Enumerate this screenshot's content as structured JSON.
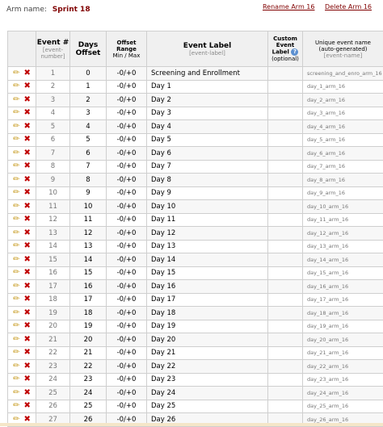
{
  "arm": {
    "label": "Arm name:",
    "name": "Sprint 18",
    "rename_link": "Rename Arm 16",
    "delete_link": "Delete Arm 16"
  },
  "headers": {
    "event_num": "Event #",
    "event_num_sub": "[event-number]",
    "days_offset_1": "Days",
    "days_offset_2": "Offset",
    "offset_range_1": "Offset",
    "offset_range_2": "Range",
    "offset_range_sub": "Min / Max",
    "event_label": "Event Label",
    "event_label_sub": "[event-label]",
    "custom_1": "Custom",
    "custom_2": "Event",
    "custom_3": "Label",
    "custom_sub": "(optional)",
    "unique_1": "Unique event name",
    "unique_2": "(auto-generated)",
    "unique_sub": "[event-name]",
    "help_glyph": "?"
  },
  "icons": {
    "edit": "pencil-icon",
    "delete": "delete-icon",
    "help": "help-icon"
  },
  "events": [
    {
      "num": "1",
      "days": "0",
      "range": "-0/+0",
      "label": "Screening and Enrollment",
      "unique": "screening_and_enro_arm_16"
    },
    {
      "num": "2",
      "days": "1",
      "range": "-0/+0",
      "label": "Day 1",
      "unique": "day_1_arm_16"
    },
    {
      "num": "3",
      "days": "2",
      "range": "-0/+0",
      "label": "Day 2",
      "unique": "day_2_arm_16"
    },
    {
      "num": "4",
      "days": "3",
      "range": "-0/+0",
      "label": "Day 3",
      "unique": "day_3_arm_16"
    },
    {
      "num": "5",
      "days": "4",
      "range": "-0/+0",
      "label": "Day 4",
      "unique": "day_4_arm_16"
    },
    {
      "num": "6",
      "days": "5",
      "range": "-0/+0",
      "label": "Day 5",
      "unique": "day_5_arm_16"
    },
    {
      "num": "7",
      "days": "6",
      "range": "-0/+0",
      "label": "Day 6",
      "unique": "day_6_arm_16"
    },
    {
      "num": "8",
      "days": "7",
      "range": "-0/+0",
      "label": "Day 7",
      "unique": "day_7_arm_16"
    },
    {
      "num": "9",
      "days": "8",
      "range": "-0/+0",
      "label": "Day 8",
      "unique": "day_8_arm_16"
    },
    {
      "num": "10",
      "days": "9",
      "range": "-0/+0",
      "label": "Day 9",
      "unique": "day_9_arm_16"
    },
    {
      "num": "11",
      "days": "10",
      "range": "-0/+0",
      "label": "Day 10",
      "unique": "day_10_arm_16"
    },
    {
      "num": "12",
      "days": "11",
      "range": "-0/+0",
      "label": "Day 11",
      "unique": "day_11_arm_16"
    },
    {
      "num": "13",
      "days": "12",
      "range": "-0/+0",
      "label": "Day 12",
      "unique": "day_12_arm_16"
    },
    {
      "num": "14",
      "days": "13",
      "range": "-0/+0",
      "label": "Day 13",
      "unique": "day_13_arm_16"
    },
    {
      "num": "15",
      "days": "14",
      "range": "-0/+0",
      "label": "Day 14",
      "unique": "day_14_arm_16"
    },
    {
      "num": "16",
      "days": "15",
      "range": "-0/+0",
      "label": "Day 15",
      "unique": "day_15_arm_16"
    },
    {
      "num": "17",
      "days": "16",
      "range": "-0/+0",
      "label": "Day 16",
      "unique": "day_16_arm_16"
    },
    {
      "num": "18",
      "days": "17",
      "range": "-0/+0",
      "label": "Day 17",
      "unique": "day_17_arm_16"
    },
    {
      "num": "19",
      "days": "18",
      "range": "-0/+0",
      "label": "Day 18",
      "unique": "day_18_arm_16"
    },
    {
      "num": "20",
      "days": "19",
      "range": "-0/+0",
      "label": "Day 19",
      "unique": "day_19_arm_16"
    },
    {
      "num": "21",
      "days": "20",
      "range": "-0/+0",
      "label": "Day 20",
      "unique": "day_20_arm_16"
    },
    {
      "num": "22",
      "days": "21",
      "range": "-0/+0",
      "label": "Day 21",
      "unique": "day_21_arm_16"
    },
    {
      "num": "23",
      "days": "22",
      "range": "-0/+0",
      "label": "Day 22",
      "unique": "day_22_arm_16"
    },
    {
      "num": "24",
      "days": "23",
      "range": "-0/+0",
      "label": "Day 23",
      "unique": "day_23_arm_16"
    },
    {
      "num": "25",
      "days": "24",
      "range": "-0/+0",
      "label": "Day 24",
      "unique": "day_24_arm_16"
    },
    {
      "num": "26",
      "days": "25",
      "range": "-0/+0",
      "label": "Day 25",
      "unique": "day_25_arm_16"
    },
    {
      "num": "27",
      "days": "26",
      "range": "-0/+0",
      "label": "Day 26",
      "unique": "day_26_arm_16"
    }
  ]
}
